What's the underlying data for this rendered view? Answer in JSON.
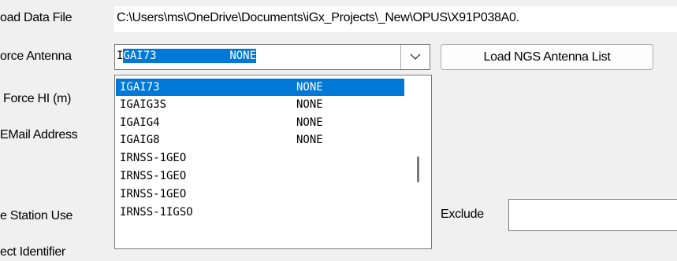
{
  "labels": {
    "load_data_file": "oad Data File",
    "force_antenna": "orce Antenna",
    "force_hi": "Force HI (m)",
    "email_address": "EMail Address",
    "station_use": "e Station Use",
    "project_identifier": "ect Identifier",
    "exclude": "Exclude"
  },
  "file_path": "C:\\Users\\ms\\OneDrive\\Documents\\iGx_Projects\\_New\\OPUS\\X91P038A0.",
  "combo": {
    "prefix": "I",
    "selected_rest": "GAI73",
    "gap": "           ",
    "selected_radome": "NONE"
  },
  "buttons": {
    "load_ngs": "Load NGS Antenna List"
  },
  "dropdown_items": [
    {
      "name": "IGAI73",
      "radome": "NONE"
    },
    {
      "name": "IGAIG3S",
      "radome": "NONE"
    },
    {
      "name": "IGAIG4",
      "radome": "NONE"
    },
    {
      "name": "IGAIG8",
      "radome": "NONE"
    },
    {
      "name": "IRNSS-1GEO",
      "radome": ""
    },
    {
      "name": "IRNSS-1GEO",
      "radome": ""
    },
    {
      "name": "IRNSS-1GEO",
      "radome": ""
    },
    {
      "name": "IRNSS-1IGSO",
      "radome": ""
    }
  ],
  "exclude_value": "",
  "icons": {
    "combo_arrow": "chevron-down-icon",
    "scroll_thumb": "scrollbar-thumb"
  }
}
